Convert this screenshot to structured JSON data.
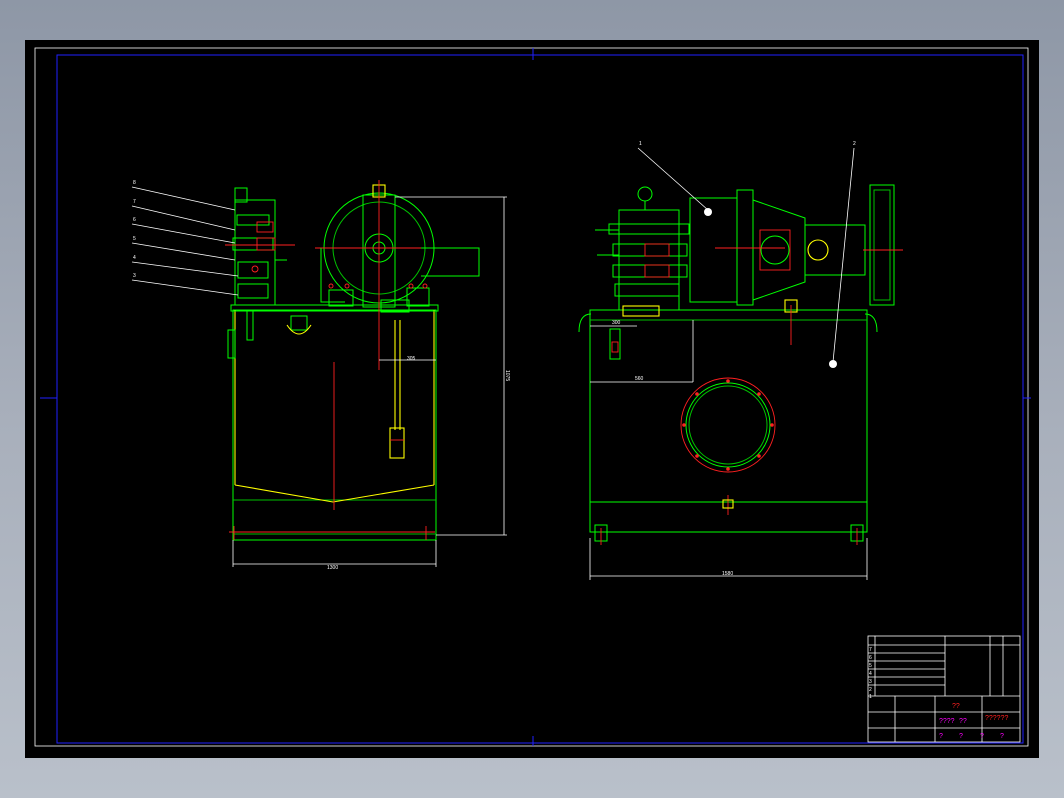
{
  "drawing": {
    "left_view": {
      "balloons": [
        "8",
        "7",
        "6",
        "5",
        "4",
        "3"
      ],
      "dim_width": "1300",
      "dim_height": "1075",
      "dim_top": "305"
    },
    "right_view": {
      "balloons": [
        "1",
        "2"
      ],
      "dim_width": "1580",
      "dim_a": "300",
      "dim_b": "560"
    },
    "title_block": {
      "left_code_1": "7",
      "left_code_2": "6",
      "left_code_3": "5",
      "left_code_4": "4",
      "left_code_5": "3",
      "left_code_6": "2",
      "left_code_7": "1",
      "cell_qq": "??",
      "cell_name": "??????",
      "cell_a": "????",
      "cell_b": "??",
      "cell_c": "?",
      "cell_d": "?",
      "cell_e": "?",
      "cell_f": "?"
    }
  }
}
